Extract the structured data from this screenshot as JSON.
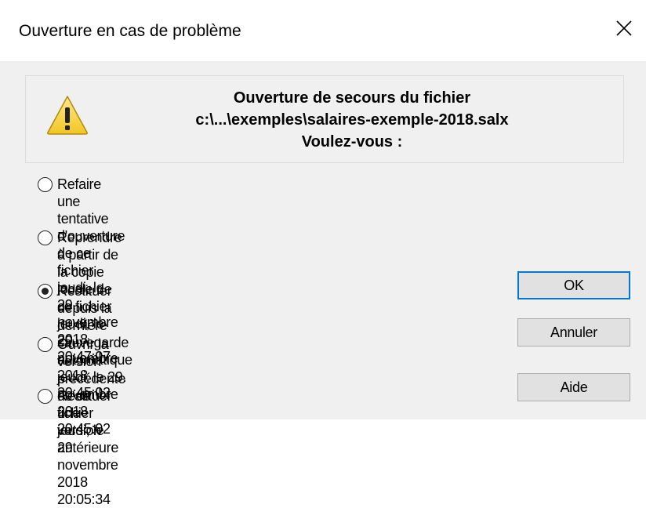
{
  "window": {
    "title": "Ouverture en cas de problème",
    "close_symbol": "✕"
  },
  "header": {
    "line1": "Ouverture de secours du fichier",
    "line2": "c:\\...\\exemples\\salaires-exemple-2018.salx",
    "line3": "Voulez-vous :",
    "icon": "warning-icon"
  },
  "options": [
    {
      "label": "Refaire une tentative d'ouverture de ce fichier",
      "date": "jeudi, le 29. novembre 2018 20:47:07",
      "selected": false
    },
    {
      "label": "Reprendre à partir de la copie locale de ce fichier",
      "date": "jeudi, le 29. novembre 2018 20:45:02",
      "selected": false
    },
    {
      "label": "Restituer depuis la dernière sauvegarde automatique",
      "date": "jeudi, le 29. novembre 2018 20:45:02",
      "selected": true
    },
    {
      "label": "Ouvrir la version précédente de ce fichier",
      "date": "jeudi, le 29. novembre 2018 20:05:34",
      "selected": false
    },
    {
      "label": "Restituer une version antérieure",
      "date": "",
      "selected": false
    }
  ],
  "buttons": {
    "ok": "OK",
    "cancel": "Annuler",
    "help": "Aide"
  },
  "colors": {
    "default_button_border": "#0078d7",
    "warning_fill": "#f8d64e",
    "dialog_background": "#f0f0f0"
  }
}
